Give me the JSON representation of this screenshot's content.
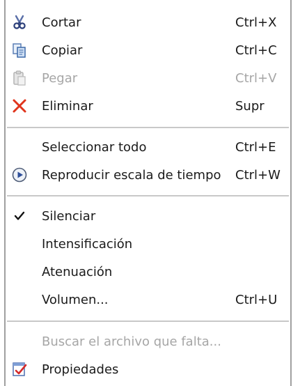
{
  "menu": {
    "items": [
      {
        "label": "Cortar",
        "shortcut": "Ctrl+X",
        "icon": "scissors-icon",
        "enabled": true
      },
      {
        "label": "Copiar",
        "shortcut": "Ctrl+C",
        "icon": "copy-icon",
        "enabled": true
      },
      {
        "label": "Pegar",
        "shortcut": "Ctrl+V",
        "icon": "paste-icon",
        "enabled": false
      },
      {
        "label": "Eliminar",
        "shortcut": "Supr",
        "icon": "delete-x-icon",
        "enabled": true
      },
      {
        "label": "Seleccionar todo",
        "shortcut": "Ctrl+E",
        "enabled": true
      },
      {
        "label": "Reproducir escala de tiempo",
        "shortcut": "Ctrl+W",
        "icon": "play-circle-icon",
        "enabled": true
      },
      {
        "label": "Silenciar",
        "icon": "checkmark-icon",
        "checked": true,
        "enabled": true
      },
      {
        "label": "Intensificación",
        "enabled": true
      },
      {
        "label": "Atenuación",
        "enabled": true
      },
      {
        "label": "Volumen...",
        "shortcut": "Ctrl+U",
        "enabled": true
      },
      {
        "label": "Buscar el archivo que falta...",
        "enabled": false
      },
      {
        "label": "Propiedades",
        "icon": "properties-icon",
        "enabled": true
      }
    ]
  },
  "colors": {
    "delete": "#e0341c",
    "disabled_text": "#a6a6a6",
    "separator": "#c8c8c8",
    "border": "#a0a0a0"
  }
}
